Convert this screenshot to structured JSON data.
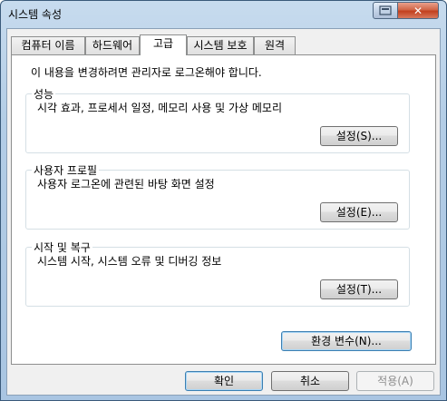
{
  "window": {
    "title": "시스템 속성",
    "help_icon": "help-icon",
    "close_icon": "close-icon",
    "close_glyph": "✕",
    "help_glyph": "⧉"
  },
  "tabs": [
    {
      "label": "컴퓨터 이름",
      "active": false
    },
    {
      "label": "하드웨어",
      "active": false
    },
    {
      "label": "고급",
      "active": true
    },
    {
      "label": "시스템 보호",
      "active": false
    },
    {
      "label": "원격",
      "active": false
    }
  ],
  "notice": "이 내용을 변경하려면 관리자로 로그온해야 합니다.",
  "groups": {
    "performance": {
      "label": "성능",
      "desc": "시각 효과, 프로세서 일정, 메모리 사용 및 가상 메모리",
      "button": "설정(S)..."
    },
    "user_profiles": {
      "label": "사용자 프로필",
      "desc": "사용자 로그온에 관련된 바탕 화면 설정",
      "button": "설정(E)..."
    },
    "startup_recovery": {
      "label": "시작 및 복구",
      "desc": "시스템 시작, 시스템 오류 및 디버깅 정보",
      "button": "설정(T)..."
    }
  },
  "env_button": "환경 변수(N)...",
  "footer": {
    "ok": "확인",
    "cancel": "취소",
    "apply": "적용(A)",
    "apply_enabled": false
  }
}
